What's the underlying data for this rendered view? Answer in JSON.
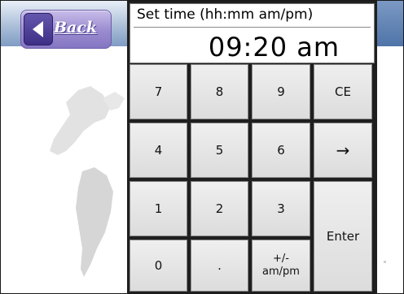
{
  "header": {
    "back_label": "Back"
  },
  "display": {
    "label": "Set time (hh:mm am/pm)",
    "value": "09:20 am"
  },
  "keypad": {
    "k7": "7",
    "k8": "8",
    "k9": "9",
    "ce": "CE",
    "k4": "4",
    "k5": "5",
    "k6": "6",
    "arrow": "→",
    "k1": "1",
    "k2": "2",
    "k3": "3",
    "enter": "Enter",
    "k0": "0",
    "dot": ".",
    "sign_ampm": "+/-\nam/pm"
  },
  "colors": {
    "back_button": "#9a8bd0",
    "topbar": "#a6bbd6",
    "key_face": "#e6e6e6"
  }
}
